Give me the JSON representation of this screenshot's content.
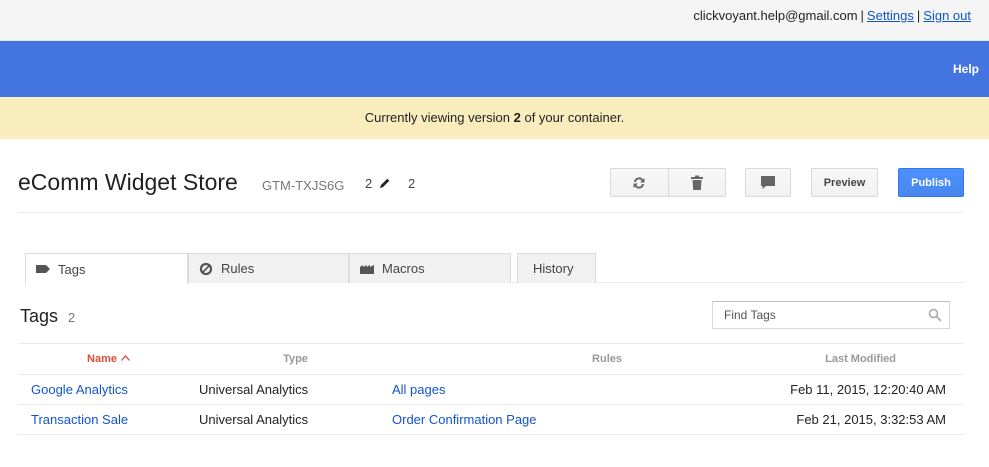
{
  "account": {
    "email": "clickvoyant.help@gmail.com",
    "settings_label": "Settings",
    "signout_label": "Sign out"
  },
  "bluebar": {
    "help_label": "Help"
  },
  "notice": {
    "prefix": "Currently viewing version ",
    "version": "2",
    "suffix": " of your container."
  },
  "container": {
    "name": "eComm Widget Store",
    "id": "GTM-TXJS6G",
    "version": "2",
    "version_count": "2"
  },
  "toolbar": {
    "refresh_icon": "refresh-icon",
    "delete_icon": "trash-icon",
    "comment_icon": "comment-icon",
    "preview_label": "Preview",
    "publish_label": "Publish",
    "publish_color": "#4d90fe"
  },
  "tabs": [
    {
      "label": "Tags",
      "icon": "tag-icon",
      "active": true
    },
    {
      "label": "Rules",
      "icon": "rules-icon",
      "active": false
    },
    {
      "label": "Macros",
      "icon": "macros-icon",
      "active": false
    },
    {
      "label": "History",
      "icon": "",
      "active": false
    }
  ],
  "section": {
    "title": "Tags",
    "count": "2",
    "search_placeholder": "Find Tags"
  },
  "table": {
    "columns": [
      "Name",
      "Type",
      "Rules",
      "Last Modified"
    ],
    "sorted_column": "Name",
    "sort_color": "#dd4b39",
    "rows": [
      {
        "name": "Google Analytics",
        "type": "Universal Analytics",
        "rule": "All pages",
        "modified": "Feb 11, 2015, 12:20:40 AM"
      },
      {
        "name": "Transaction Sale",
        "type": "Universal Analytics",
        "rule": "Order Confirmation Page",
        "modified": "Feb 21, 2015, 3:32:53 AM"
      }
    ]
  },
  "colors": {
    "topbar_bg": "#f5f5f5",
    "bluebar_bg": "#4374e0",
    "notice_bg": "#f9edbe",
    "link": "#1155cc"
  }
}
